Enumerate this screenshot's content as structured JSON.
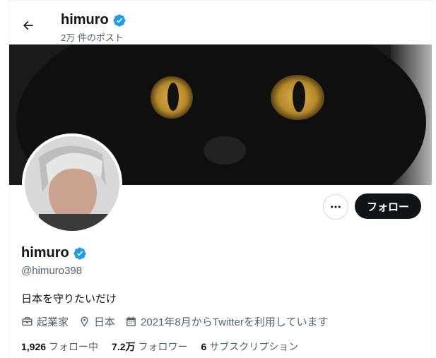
{
  "header": {
    "name": "himuro",
    "post_count": "2万 件のポスト",
    "back_icon": "arrow-left-icon"
  },
  "profile": {
    "name": "himuro",
    "handle": "@himuro398",
    "bio": "日本を守りたいだけ",
    "verified": true,
    "verified_color": "#1d9bf0"
  },
  "actions": {
    "more_icon": "more-dots-icon",
    "follow_label": "フォロー"
  },
  "meta": {
    "profession": "起業家",
    "location": "日本",
    "joined": "2021年8月からTwitterを利用しています"
  },
  "stats": {
    "following_count": "1,926",
    "following_label": "フォロー中",
    "followers_count": "7.2万",
    "followers_label": "フォロワー",
    "subscriptions_count": "6",
    "subscriptions_label": "サブスクリプション"
  },
  "colors": {
    "text": "#0f1419",
    "secondary": "#536471",
    "follow_bg": "#0f1419"
  }
}
